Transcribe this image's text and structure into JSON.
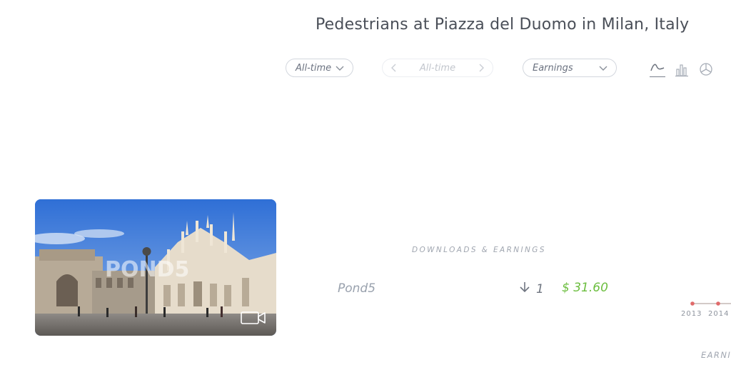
{
  "header": {
    "title": "Pedestrians at Piazza del Duomo in Milan, Italy"
  },
  "filters": {
    "period": "All-time",
    "range": "All-time",
    "metric": "Earnings"
  },
  "chart_types": [
    {
      "icon": "line-chart-icon",
      "active": true
    },
    {
      "icon": "bar-chart-icon",
      "active": false
    },
    {
      "icon": "pie-chart-icon",
      "active": false
    }
  ],
  "thumbnail": {
    "watermark": "POND5",
    "media_type_icon": "video-camera-icon"
  },
  "stats": {
    "section_label": "DOWNLOADS & EARNINGS",
    "rows": [
      {
        "source": "Pond5",
        "downloads": "1",
        "earnings": "$ 31.60"
      }
    ]
  },
  "timeline": {
    "years": [
      "2013",
      "2014"
    ],
    "label": "EARNI"
  },
  "colors": {
    "title": "#4a4f58",
    "earnings": "#6cbe3f",
    "timeline_dot": "#e06a6a"
  }
}
